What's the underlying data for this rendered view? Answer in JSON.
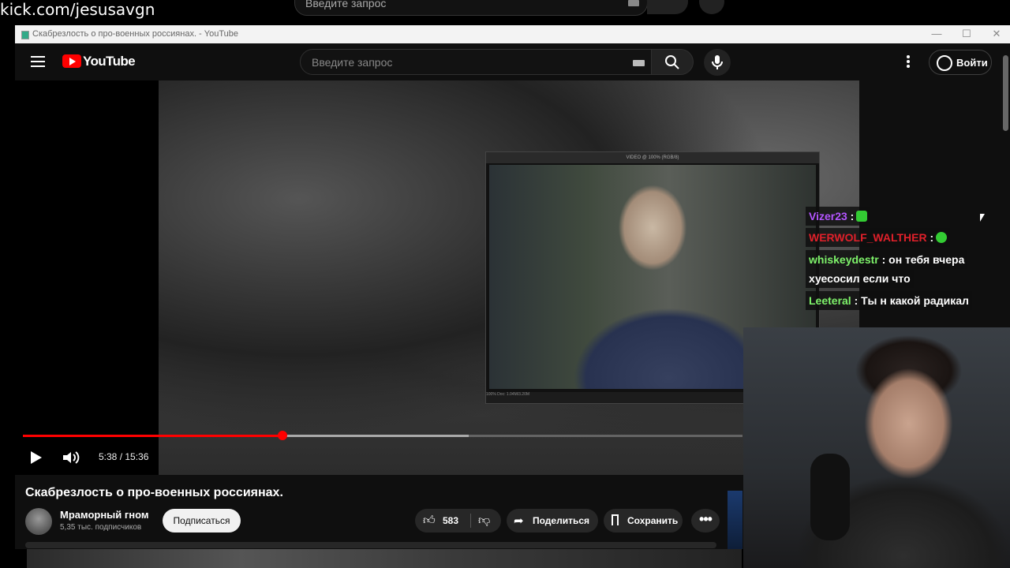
{
  "stream_overlay": {
    "channel_url": "kick.com/jesusavgn",
    "bg_search_placeholder": "Введите запрос"
  },
  "browser": {
    "window_title": "Скабрезлость о про-военных россиянах. - YouTube",
    "controls": {
      "minimize": "—",
      "maximize": "☐",
      "close": "✕"
    }
  },
  "header": {
    "logo_text": "YouTube",
    "search_placeholder": "Введите запрос",
    "sign_in_label": "Войти",
    "icons": [
      "menu-icon",
      "keyboard-icon",
      "search-icon",
      "mic-icon",
      "more-vert-icon",
      "account-icon"
    ]
  },
  "player": {
    "current_time": "5:38",
    "duration": "15:36",
    "time_display": "5:38 / 15:36",
    "progress_fraction": 0.361,
    "buffer_fraction": 0.62,
    "inner_window_title": "VIDEO @ 100% (RGB/8)",
    "inner_status": "100%   Doc: 1.04M/3.20M"
  },
  "video": {
    "title": "Скабрезлость о про-военных россиянах.",
    "channel_name": "Мраморный гном",
    "subscribers": "5,35 тыс. подписчиков",
    "subscribe_label": "Подписаться",
    "like_count": "583",
    "share_label": "Поделиться",
    "save_label": "Сохранить",
    "more_label": "•••"
  },
  "chat": [
    {
      "user": "Vizer23",
      "color": "#b455ff",
      "text": "",
      "emote": true
    },
    {
      "user": "WERWOLF_WALTHER",
      "color": "#e0202a",
      "text": "",
      "emote": true
    },
    {
      "user": "whiskeydestr",
      "color": "#7ef26a",
      "text": "он тебя вчера",
      "text2": "хуесосил если что"
    },
    {
      "user": "Leeteral",
      "color": "#7ef26a",
      "text": "Ты н какой радикал"
    }
  ]
}
